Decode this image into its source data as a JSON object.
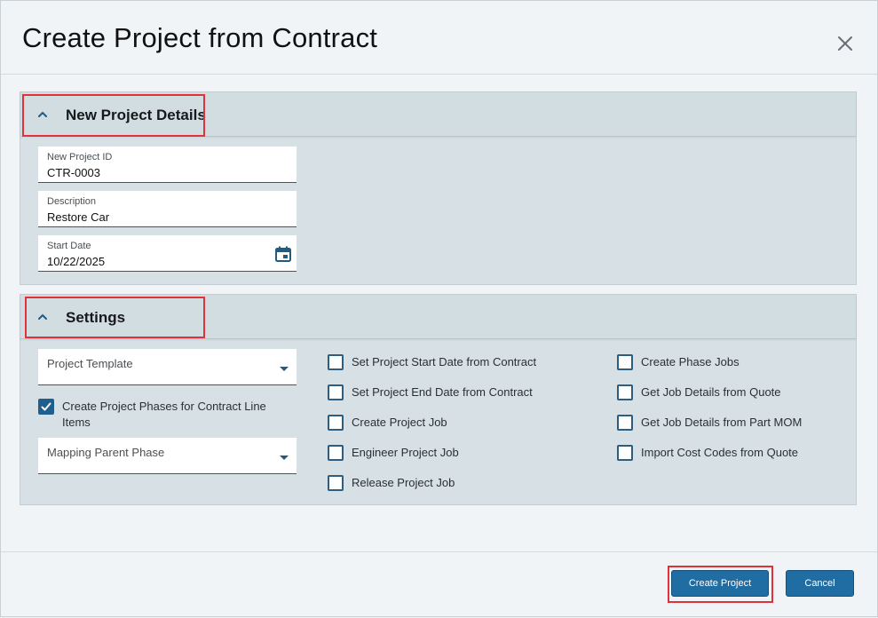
{
  "dialog": {
    "title": "Create Project from Contract",
    "close_icon": "close-icon"
  },
  "details": {
    "header": "New Project Details",
    "project_id": {
      "label": "New Project ID",
      "value": "CTR-0003"
    },
    "description": {
      "label": "Description",
      "value": "Restore Car"
    },
    "start_date": {
      "label": "Start Date",
      "value": "10/22/2025",
      "icon": "calendar-icon"
    }
  },
  "settings": {
    "header": "Settings",
    "project_template": {
      "placeholder": "Project Template"
    },
    "create_phases": {
      "label": "Create Project Phases for Contract Line Items",
      "checked": true
    },
    "mapping_parent_phase": {
      "placeholder": "Mapping Parent Phase"
    },
    "options_col2": [
      {
        "label": "Set Project Start Date from Contract",
        "checked": false
      },
      {
        "label": "Set Project End Date from Contract",
        "checked": false
      },
      {
        "label": "Create Project Job",
        "checked": false
      },
      {
        "label": "Engineer Project Job",
        "checked": false
      },
      {
        "label": "Release Project Job",
        "checked": false
      }
    ],
    "options_col3": [
      {
        "label": "Create Phase Jobs",
        "checked": false
      },
      {
        "label": "Get Job Details from Quote",
        "checked": false
      },
      {
        "label": "Get Job Details from Part MOM",
        "checked": false
      },
      {
        "label": "Import Cost Codes from Quote",
        "checked": false
      }
    ]
  },
  "footer": {
    "create_label": "Create Project",
    "cancel_label": "Cancel"
  },
  "colors": {
    "accent": "#1f6da3",
    "highlight": "#e0323a",
    "panel": "#d7e1e5"
  }
}
